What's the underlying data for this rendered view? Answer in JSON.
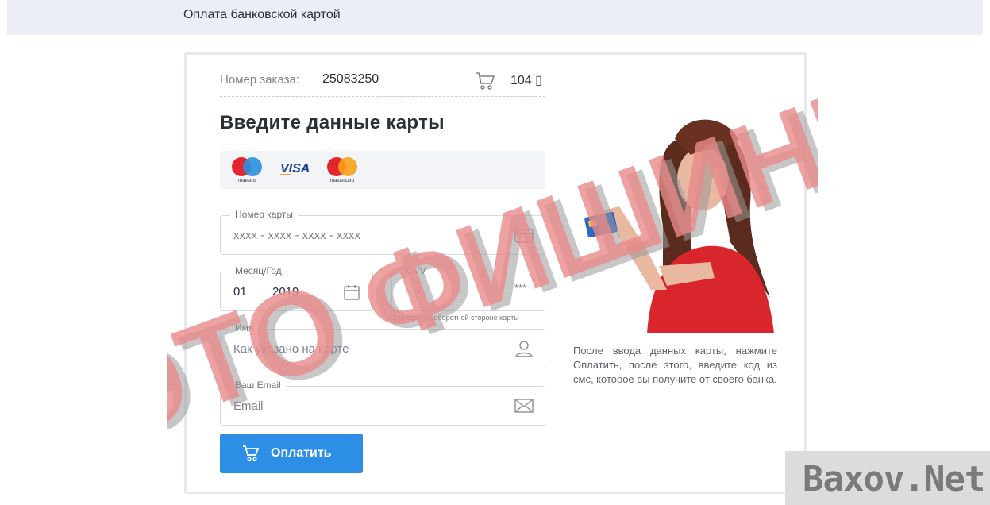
{
  "header": {
    "title": "Оплата банковской картой"
  },
  "order": {
    "label": "Номер заказа:",
    "number": "25083250",
    "amount": "104 ▯"
  },
  "form": {
    "heading": "Введите данные карты",
    "brands": [
      "maestro",
      "VISA",
      "mastercard"
    ],
    "card_number": {
      "label": "Номер карты",
      "placeholder": "xxxx - xxxx - xxxx - xxxx"
    },
    "expiry": {
      "label": "Месяц/Год",
      "month": "01",
      "year": "2019"
    },
    "cvv": {
      "label": "CVV",
      "mask": "***",
      "hint": "3 цифры на оборотной стороне карты"
    },
    "name": {
      "label": "Имя",
      "placeholder": "Как указано на карте"
    },
    "email": {
      "label": "Ваш Email",
      "placeholder": "Email"
    },
    "pay_button": "Оплатить"
  },
  "info": {
    "text": "После ввода данных карты, нажмите Оплатить, после этого, введите код из смс, которое вы получите от своего банка."
  },
  "overlay": {
    "stamp_text": "ЭТО ФИШИНГ",
    "watermark": "Baxov.Net"
  },
  "colors": {
    "accent": "#2d8ee6",
    "stamp": "#e98a8a",
    "header_bg": "#eceef6"
  }
}
